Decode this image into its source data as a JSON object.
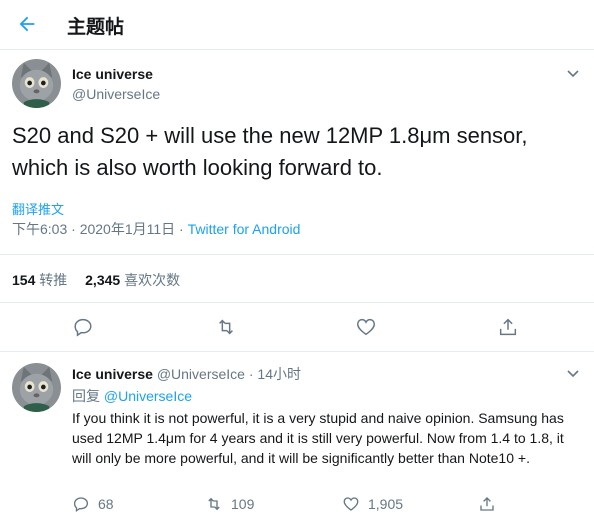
{
  "header": {
    "title": "主题帖"
  },
  "tweet": {
    "name": "Ice universe",
    "handle": "@UniverseIce",
    "text": "S20 and S20 + will use the new 12MP 1.8μm sensor, which is also worth looking forward to.",
    "translate_label": "翻译推文",
    "time": "下午6:03 · 2020年1月11日 · ",
    "source": "Twitter for Android",
    "retweets_count": "154",
    "retweets_label": "转推",
    "likes_count": "2,345",
    "likes_label": "喜欢次数"
  },
  "reply": {
    "name": "Ice universe",
    "handle": "@UniverseIce",
    "dot": "·",
    "time": "14小时",
    "replying_prefix": "回复 ",
    "replying_to": "@UniverseIce",
    "text": "If you think it is not powerful, it is a very stupid and naive opinion. Samsung has used 12MP 1.4μm for 4 years and it is still very powerful. Now from 1.4 to 1.8, it will only be more powerful, and it will be significantly better than Note10 +.",
    "reply_count": "68",
    "retweet_count": "109",
    "like_count": "1,905"
  },
  "colors": {
    "accent": "#1da1f2",
    "secondary_text": "#657786",
    "border": "#e6ecf0"
  }
}
